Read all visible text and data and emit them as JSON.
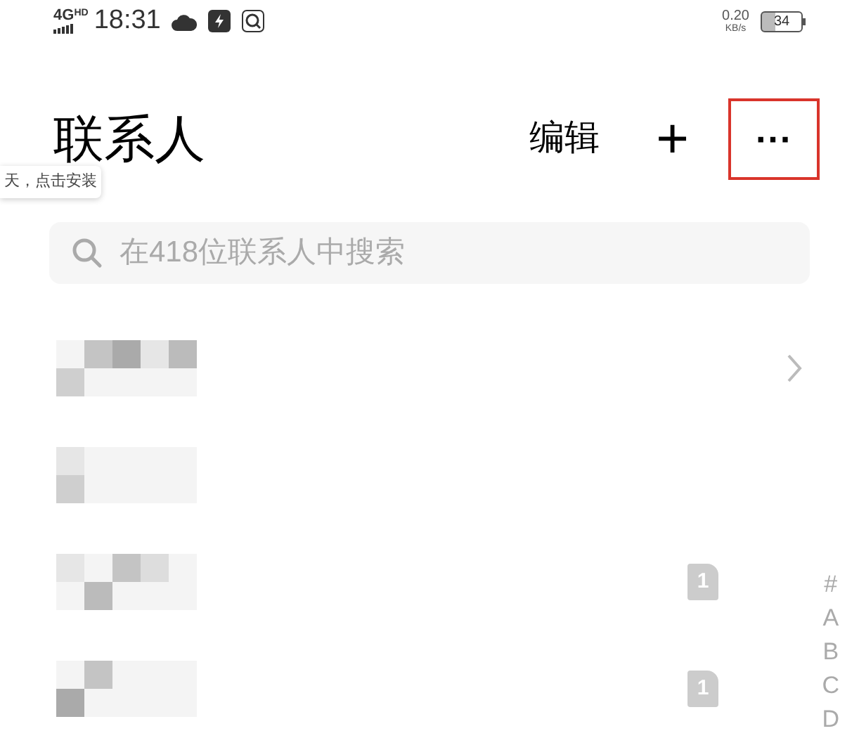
{
  "status_bar": {
    "network": "4G",
    "network_badge": "HD",
    "time": "18:31",
    "speed_value": "0.20",
    "speed_unit": "KB/s",
    "battery": "34"
  },
  "header": {
    "title": "联系人",
    "edit": "编辑",
    "add": "+",
    "more": "···",
    "more_highlighted": true
  },
  "tooltip": "天，点击安装",
  "search": {
    "placeholder": "在418位联系人中搜索"
  },
  "contacts": [
    {
      "kind": "redacted",
      "chevron": true
    },
    {
      "kind": "redacted",
      "chevron": false
    },
    {
      "kind": "redacted",
      "chevron": false,
      "sim_badge": "1"
    },
    {
      "kind": "redacted",
      "chevron": false,
      "sim_badge": "1"
    }
  ],
  "index_letters": [
    "#",
    "A",
    "B",
    "C",
    "D"
  ]
}
